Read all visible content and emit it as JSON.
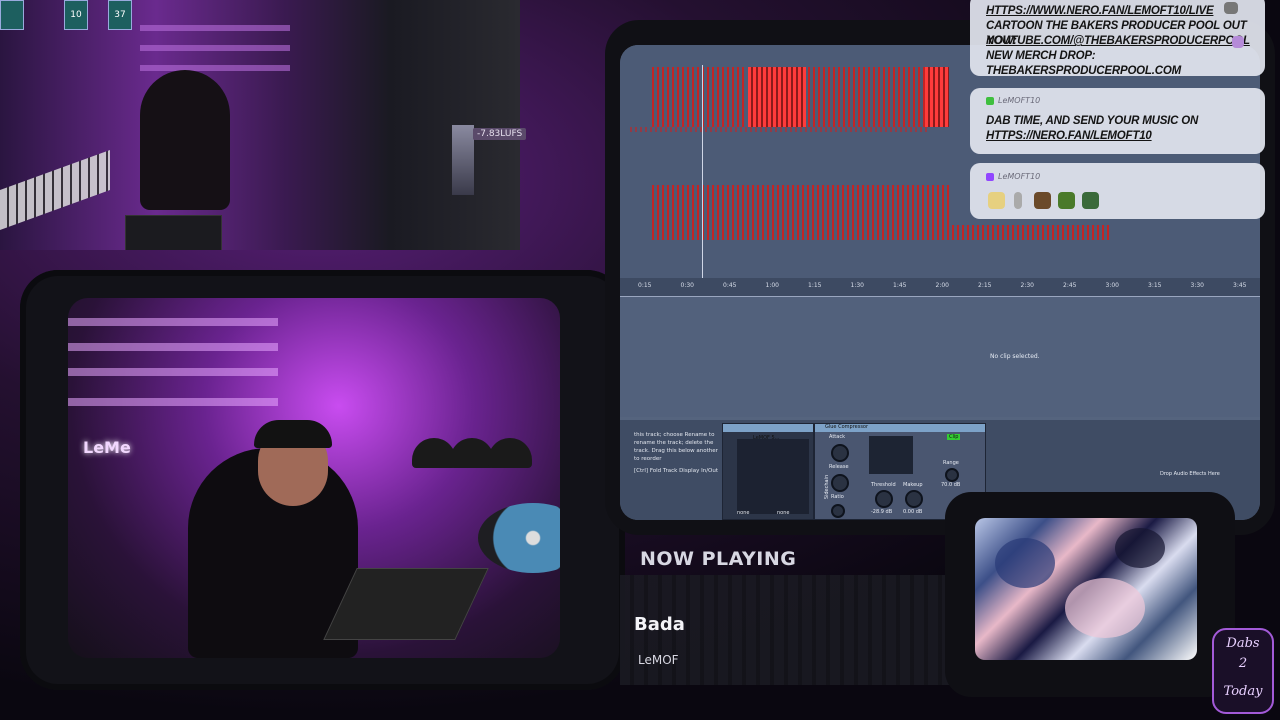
{
  "webcam_top": {
    "loudness_readout": "-7.83LUFS",
    "stickers": [
      "10",
      "37"
    ]
  },
  "webcam_main": {
    "neon_sign": "LeMe"
  },
  "daw": {
    "ruler_ticks": [
      "0:15",
      "0:30",
      "0:45",
      "1:00",
      "1:15",
      "1:30",
      "1:45",
      "2:00",
      "2:15",
      "2:30",
      "2:45",
      "3:00",
      "3:15",
      "3:30",
      "3:45"
    ],
    "clip_view_status": "No clip selected.",
    "info_text": "this track; choose Rename to rename the track; delete the track. Drag this below another to reorder",
    "fold_hint": "[Ctrl] Fold Track Display In/Out",
    "device1_name": "LeMOF 5...",
    "device2_name": "Glue Compressor",
    "device2_labels": {
      "attack": "Attack",
      "release": "Release",
      "ratio": "Ratio",
      "threshold": "Threshold",
      "makeup": "Makeup",
      "range": "Range",
      "clip": "Clip",
      "sidechain": "Sidechain",
      "threshold_value": "-28.9 dB",
      "makeup_value": "0.00 dB",
      "range_value": "70.0 dB"
    },
    "device1_selectors": [
      "none",
      "none"
    ],
    "drop_hint": "Drop Audio Effects Here"
  },
  "chat": {
    "messages": [
      {
        "user": "",
        "lines": [
          "HTTPS://WWW.NERO.FAN/LEMOFT10/LIVE",
          "CARTOON THE BAKERS PRODUCER POOL OUT NOW:",
          "YOUTUBE.COM/@THEBAKERSPRODUCERPOOL",
          "NEW MERCH DROP: THEBAKERSPRODUCERPOOL.COM"
        ]
      },
      {
        "user": "LeMOFT10",
        "lines": [
          "DAB TIME, AND SEND YOUR MUSIC ON",
          "HTTPS://NERO.FAN/LEMOFT10"
        ]
      },
      {
        "user": "LeMOFT10",
        "lines": []
      }
    ],
    "colors": {
      "bubble": "#e1e4ee",
      "user_badge": "#3fbf3f",
      "twitch_badge": "#9146ff"
    }
  },
  "now_playing": {
    "heading": "NOW PLAYING",
    "track": "Bada",
    "artist": "LeMOF"
  },
  "logo": {
    "line1": "Dabs",
    "line2": "2",
    "line3": "Today"
  }
}
